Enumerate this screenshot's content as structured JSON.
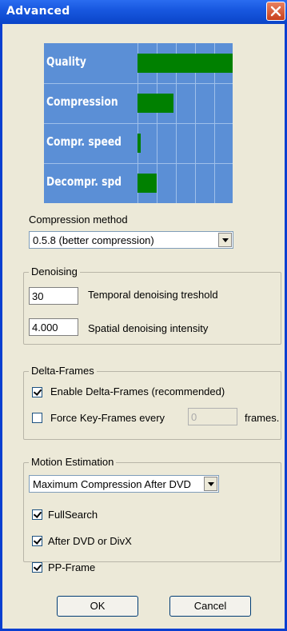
{
  "window": {
    "title": "Advanced"
  },
  "chart_data": {
    "type": "bar",
    "orientation": "horizontal",
    "categories": [
      "Quality",
      "Compression",
      "Compr. speed",
      "Decompr. spd"
    ],
    "values": [
      1.0,
      0.38,
      0.03,
      0.2
    ],
    "xlim": [
      0,
      1
    ],
    "grid": true,
    "colors": {
      "background": "#5b8fd6",
      "bar": "#008000",
      "grid": "#9fc0ea"
    }
  },
  "compression": {
    "label": "Compression method",
    "selected": "0.5.8 (better compression)"
  },
  "denoising": {
    "title": "Denoising",
    "temporal_value": "30",
    "temporal_label": "Temporal denoising treshold",
    "spatial_value": "4.000",
    "spatial_label": "Spatial denoising intensity"
  },
  "delta": {
    "title": "Delta-Frames",
    "enable_label": "Enable Delta-Frames (recommended)",
    "enable_checked": true,
    "force_label": "Force Key-Frames every",
    "force_checked": false,
    "force_value": "0",
    "frames_label": "frames."
  },
  "motion": {
    "title": "Motion Estimation",
    "selected": "Maximum Compression After DVD",
    "fullsearch_label": "FullSearch",
    "fullsearch_checked": true,
    "afterdvd_label": "After DVD or DivX",
    "afterdvd_checked": true,
    "ppframe_label": "PP-Frame",
    "ppframe_checked": true
  },
  "buttons": {
    "ok": "OK",
    "cancel": "Cancel"
  },
  "icons": {
    "close": "close-icon"
  }
}
